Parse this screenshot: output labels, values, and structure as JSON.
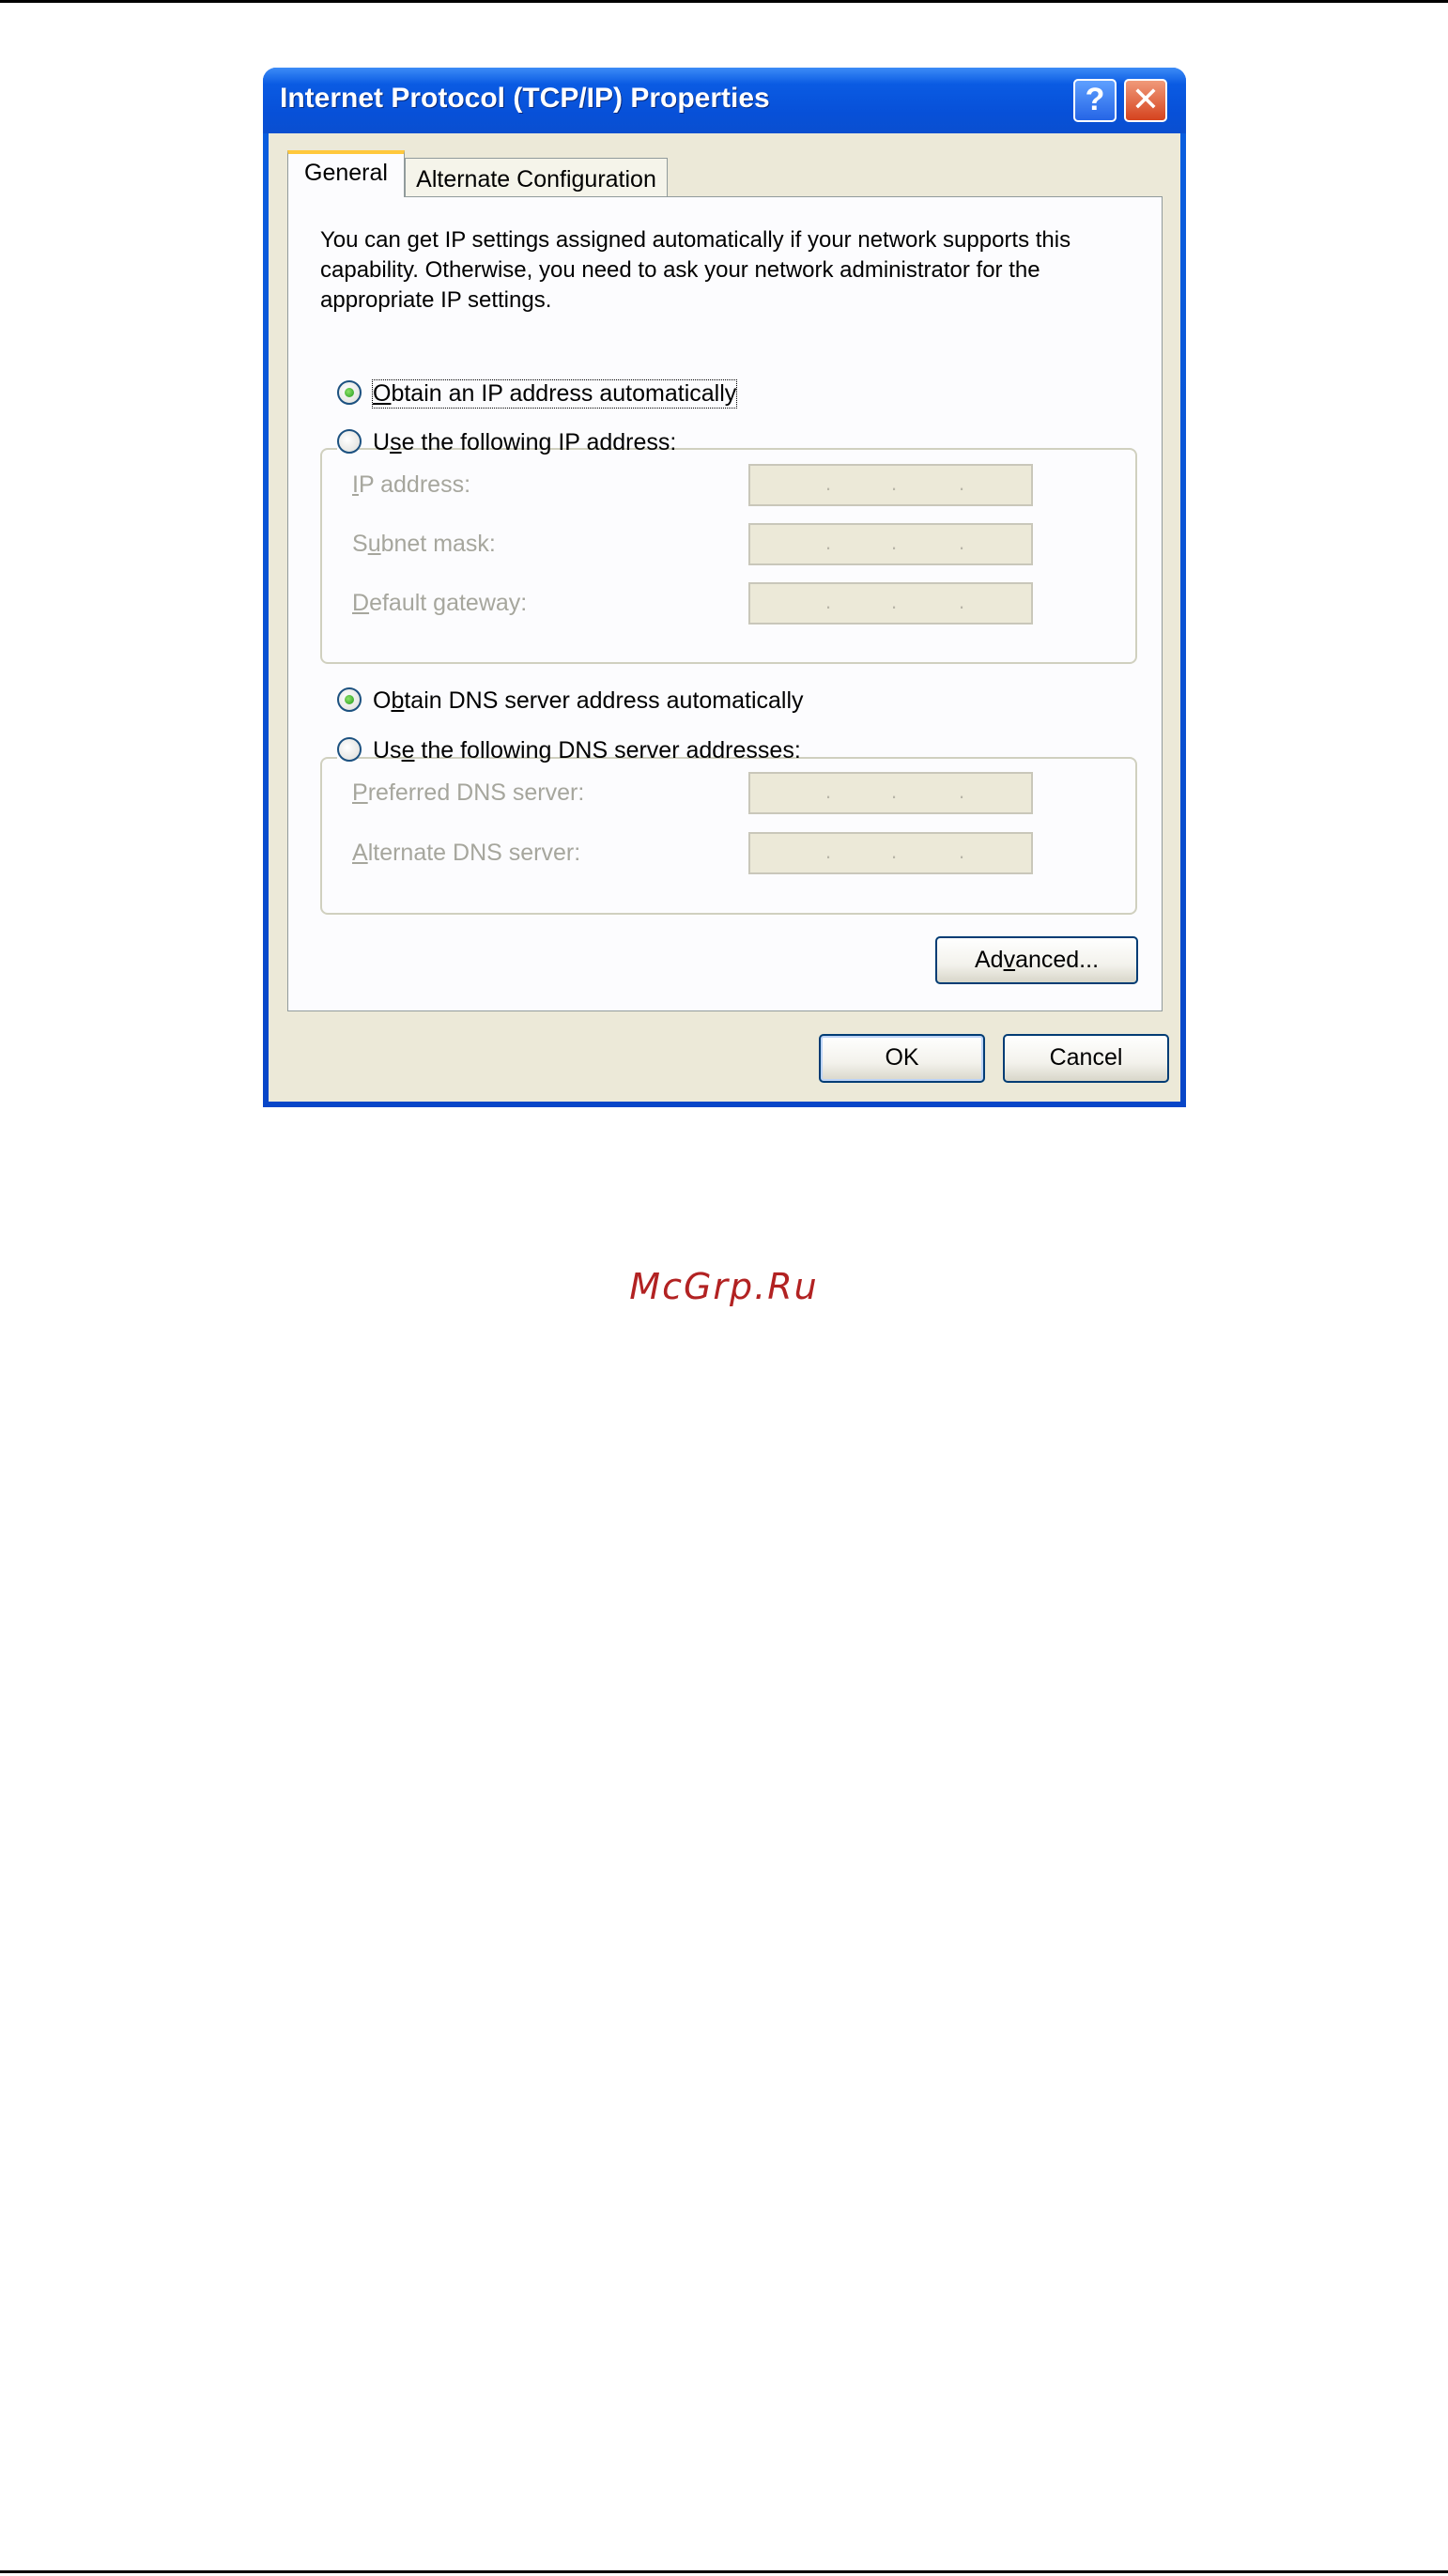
{
  "window": {
    "title": "Internet Protocol (TCP/IP) Properties",
    "help_glyph": "?",
    "close_glyph": "✕"
  },
  "tabs": [
    {
      "label": "General",
      "selected": true
    },
    {
      "label": "Alternate Configuration",
      "selected": false
    }
  ],
  "general": {
    "intro": "You can get IP settings assigned automatically if your network supports this capability. Otherwise, you need to ask your network administrator for the appropriate IP settings.",
    "ip_mode": {
      "auto": {
        "pre": "",
        "accel": "O",
        "post": "btain an IP address automatically",
        "checked": true
      },
      "manual": {
        "pre": "U",
        "accel": "s",
        "post": "e the following IP address:",
        "checked": false
      }
    },
    "ip_fields": [
      {
        "pre": "",
        "accel": "I",
        "post": "P address:",
        "value": ". . ."
      },
      {
        "pre": "S",
        "accel": "u",
        "post": "bnet mask:",
        "value": ". . ."
      },
      {
        "pre": "",
        "accel": "D",
        "post": "efault gateway:",
        "value": ". . ."
      }
    ],
    "dns_mode": {
      "auto": {
        "pre": "O",
        "accel": "b",
        "post": "tain DNS server address automatically",
        "checked": true
      },
      "manual": {
        "pre": "Us",
        "accel": "e",
        "post": " the following DNS server addresses:",
        "checked": false
      }
    },
    "dns_fields": [
      {
        "pre": "",
        "accel": "P",
        "post": "referred DNS server:",
        "value": ". . ."
      },
      {
        "pre": "",
        "accel": "A",
        "post": "lternate DNS server:",
        "value": ". . ."
      }
    ],
    "advanced_button": {
      "pre": "Ad",
      "accel": "v",
      "post": "anced..."
    }
  },
  "footer": {
    "ok_label": "OK",
    "cancel_label": "Cancel"
  },
  "watermark": "McGrp.Ru"
}
